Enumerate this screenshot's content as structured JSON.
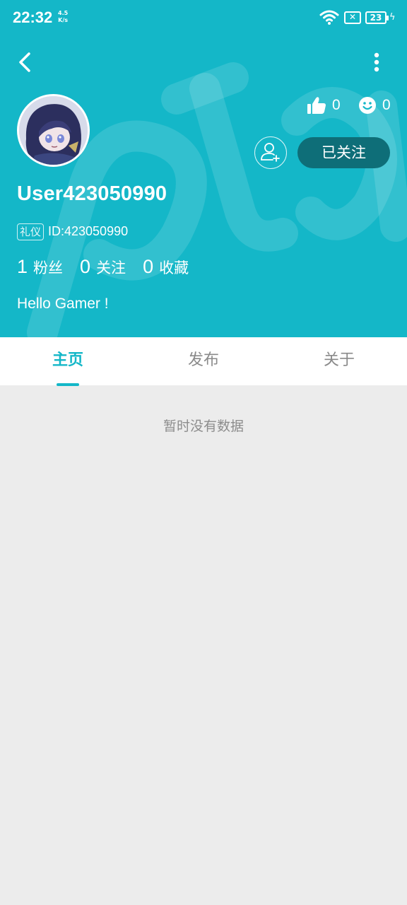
{
  "status_bar": {
    "time": "22:32",
    "net_speed_value": "4.5",
    "net_speed_unit": "K/s",
    "battery": "23"
  },
  "profile": {
    "likes_count": "0",
    "smiles_count": "0",
    "follow_label": "已关注",
    "username": "User423050990",
    "badge": "礼仪",
    "user_id": "ID:423050990",
    "stats": [
      {
        "value": "1",
        "label": "粉丝"
      },
      {
        "value": "0",
        "label": "关注"
      },
      {
        "value": "0",
        "label": "收藏"
      }
    ],
    "bio": "Hello Gamer !"
  },
  "tabs": [
    {
      "label": "主页",
      "active": true
    },
    {
      "label": "发布",
      "active": false
    },
    {
      "label": "关于",
      "active": false
    }
  ],
  "empty_message": "暂时没有数据",
  "colors": {
    "accent": "#14b7c8",
    "follow_button": "#0e6e78",
    "background": "#ececec"
  }
}
